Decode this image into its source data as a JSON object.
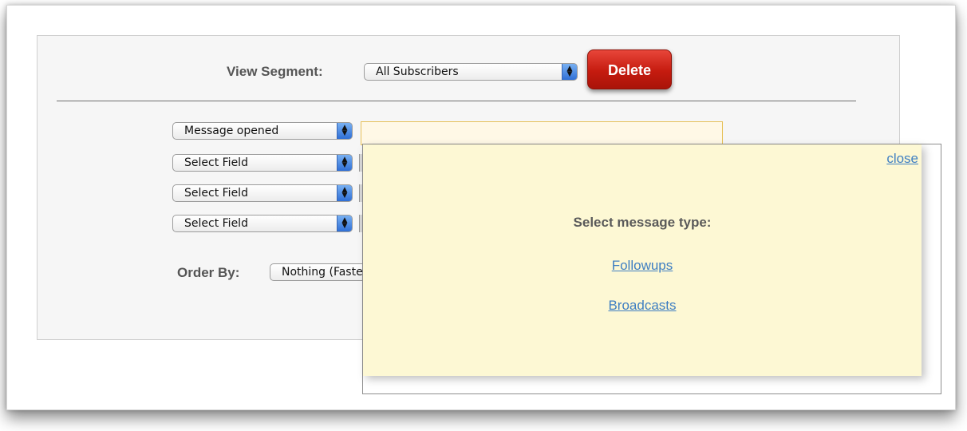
{
  "segment": {
    "label": "View Segment:",
    "selected": "All Subscribers",
    "delete_label": "Delete"
  },
  "filters": [
    {
      "selected": "Message opened"
    },
    {
      "selected": "Select Field"
    },
    {
      "selected": "Select Field"
    },
    {
      "selected": "Select Field"
    }
  ],
  "order_by": {
    "label": "Order By:",
    "selected": "Nothing (Fastest)"
  },
  "popup": {
    "close_label": "close",
    "title": "Select message type:",
    "options": [
      "Followups",
      "Broadcasts"
    ]
  },
  "colors": {
    "delete_button": "#c51b0f",
    "popup_background": "#fdf8d4",
    "link": "#3f7fc2"
  }
}
